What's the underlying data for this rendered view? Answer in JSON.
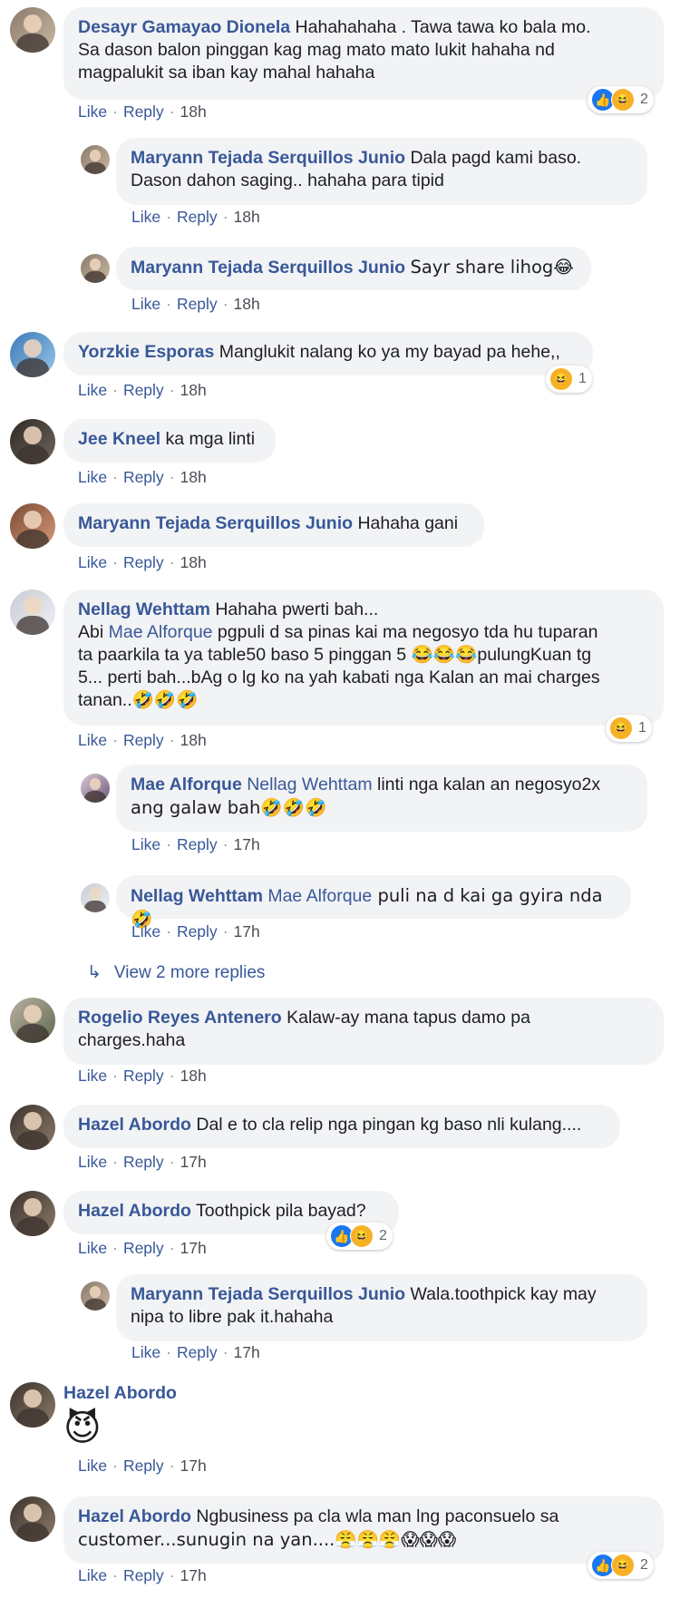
{
  "colors": {
    "author": "#385898",
    "bubble": "#f2f3f5",
    "meta": "#4b4f56"
  },
  "actions": {
    "like": "Like",
    "reply": "Reply",
    "dot": "·"
  },
  "comments": [
    {
      "author": "Desayr Gamayao Dionela",
      "lines": [
        "Hahahahaha . Tawa tawa ko bala mo.",
        "Sa dason balon pinggan kag mag mato mato lukit hahaha nd",
        "magpalukit sa iban kay mahal hahaha"
      ],
      "time": "18h",
      "reaction_count": "2",
      "reaction_icons": [
        "like-icon",
        "haha-icon"
      ]
    },
    {
      "author": "Maryann Tejada Serquillos Junio",
      "lines": [
        "Dala pagd kami baso.",
        "Dason dahon saging.. hahaha para tipid"
      ],
      "time": "18h"
    },
    {
      "author": "Maryann Tejada Serquillos Junio",
      "lines": [
        "Sayr share lihog😂"
      ],
      "time": "18h"
    },
    {
      "author": "Yorzkie Esporas",
      "lines": [
        "Manglukit nalang ko ya my bayad pa hehe,,"
      ],
      "time": "18h",
      "reaction_count": "1",
      "reaction_icons": [
        "haha-icon"
      ]
    },
    {
      "author": "Jee Kneel",
      "lines": [
        "ka mga linti"
      ],
      "time": "18h"
    },
    {
      "author": "Maryann Tejada Serquillos Junio",
      "lines": [
        "Hahaha gani"
      ],
      "time": "18h"
    },
    {
      "author": "Nellag Wehttam",
      "line1": "Hahaha pwerti bah...",
      "line2_pre": "Abi ",
      "line2_mention": "Mae Alforque",
      "line2_post": " pgpuli d sa pinas kai ma negosyo tda hu tuparan",
      "line3": "ta paarkila ta ya table50 baso 5 pinggan 5 😂😂😂pulungKuan tg",
      "line4": "5... perti bah...bAg o lg ko na yah kabati nga Kalan an mai charges",
      "line5": "tanan..🤣🤣🤣",
      "time": "18h",
      "reaction_count": "1",
      "reaction_icons": [
        "haha-icon"
      ]
    },
    {
      "author": "Mae Alforque",
      "mention": "Nellag Wehttam",
      "lines": [
        " linti nga kalan an negosyo2x",
        "ang galaw bah🤣🤣🤣"
      ],
      "time": "17h"
    },
    {
      "author": "Nellag Wehttam",
      "mention": "Mae Alforque",
      "lines": [
        " puli na d kai ga gyira nda 🤣"
      ],
      "time": "17h"
    },
    {
      "view_more": "View 2 more replies"
    },
    {
      "author": "Rogelio Reyes Antenero",
      "lines": [
        "Kalaw-ay mana tapus damo pa",
        "charges.haha"
      ],
      "time": "18h"
    },
    {
      "author": "Hazel Abordo",
      "lines": [
        "Dal e to cla relip nga pingan kg baso nli kulang...."
      ],
      "time": "17h"
    },
    {
      "author": "Hazel Abordo",
      "lines": [
        "Toothpick pila bayad?"
      ],
      "time": "17h",
      "reaction_count": "2",
      "reaction_icons": [
        "like-icon",
        "haha-icon"
      ]
    },
    {
      "author": "Maryann Tejada Serquillos Junio",
      "lines": [
        "Wala.toothpick kay may",
        "nipa to libre pak it.hahaha"
      ],
      "time": "17h"
    },
    {
      "author": "Hazel Abordo",
      "emoji": "😈",
      "time": "17h"
    },
    {
      "author": "Hazel Abordo",
      "lines": [
        "Ngbusiness pa cla wla man lng paconsuelo sa",
        "customer...sunugin na yan....😤😤😤😱😱😱"
      ],
      "time": "17h",
      "reaction_count": "2",
      "reaction_icons": [
        "like-icon",
        "haha-icon"
      ]
    }
  ]
}
